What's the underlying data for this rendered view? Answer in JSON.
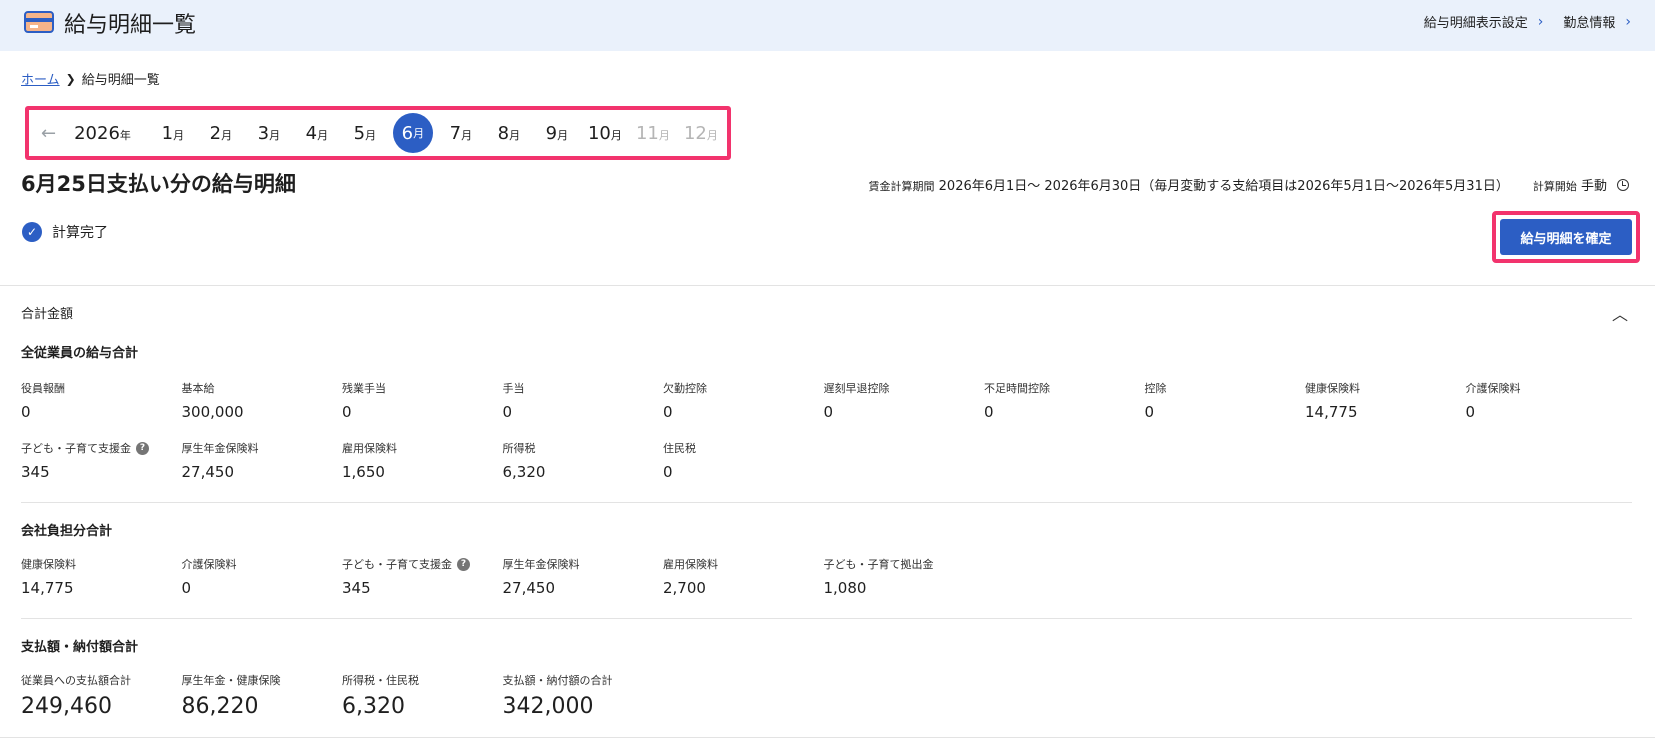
{
  "header": {
    "title": "給与明細一覧",
    "links": [
      "給与明細表示設定",
      "勤怠情報"
    ]
  },
  "breadcrumb": {
    "home": "ホーム",
    "current": "給与明細一覧"
  },
  "month_nav": {
    "year": "2026",
    "year_suffix": "年",
    "month_suffix": "月",
    "months": [
      "1",
      "2",
      "3",
      "4",
      "5",
      "6",
      "7",
      "8",
      "9",
      "10",
      "11",
      "12"
    ],
    "selected": "6",
    "disabled": [
      "11",
      "12"
    ]
  },
  "page_heading": "6月25日支払い分の給与明細",
  "period": {
    "label": "賃金計算期間",
    "value": "2026年6月1日〜 2026年6月30日（毎月変動する支給項目は2026年5月1日〜2026年5月31日）",
    "calc_start_label": "計算開始",
    "calc_start_value": "手動"
  },
  "status": "計算完了",
  "confirm_button": "給与明細を確定",
  "total_section": "合計金額",
  "employee_totals": {
    "title": "全従業員の給与合計",
    "row1": [
      {
        "label": "役員報酬",
        "value": "0"
      },
      {
        "label": "基本給",
        "value": "300,000"
      },
      {
        "label": "残業手当",
        "value": "0"
      },
      {
        "label": "手当",
        "value": "0"
      },
      {
        "label": "欠勤控除",
        "value": "0"
      },
      {
        "label": "遅刻早退控除",
        "value": "0"
      },
      {
        "label": "不足時間控除",
        "value": "0"
      },
      {
        "label": "控除",
        "value": "0"
      },
      {
        "label": "健康保険料",
        "value": "14,775"
      },
      {
        "label": "介護保険料",
        "value": "0"
      }
    ],
    "row2": [
      {
        "label": "子ども・子育て支援金",
        "value": "345"
      },
      {
        "label": "厚生年金保険料",
        "value": "27,450"
      },
      {
        "label": "雇用保険料",
        "value": "1,650"
      },
      {
        "label": "所得税",
        "value": "6,320"
      },
      {
        "label": "住民税",
        "value": "0"
      }
    ]
  },
  "company_totals": {
    "title": "会社負担分合計",
    "items": [
      {
        "label": "健康保険料",
        "value": "14,775"
      },
      {
        "label": "介護保険料",
        "value": "0"
      },
      {
        "label": "子ども・子育て支援金",
        "value": "345"
      },
      {
        "label": "厚生年金保険料",
        "value": "27,450"
      },
      {
        "label": "雇用保険料",
        "value": "2,700"
      },
      {
        "label": "子ども・子育て拠出金",
        "value": "1,080"
      }
    ]
  },
  "payment_totals": {
    "title": "支払額・納付額合計",
    "items": [
      {
        "label": "従業員への支払額合計",
        "value": "249,460"
      },
      {
        "label": "厚生年金・健康保険",
        "value": "86,220"
      },
      {
        "label": "所得税・住民税",
        "value": "6,320"
      },
      {
        "label": "支払額・納付額の合計",
        "value": "342,000"
      }
    ]
  }
}
